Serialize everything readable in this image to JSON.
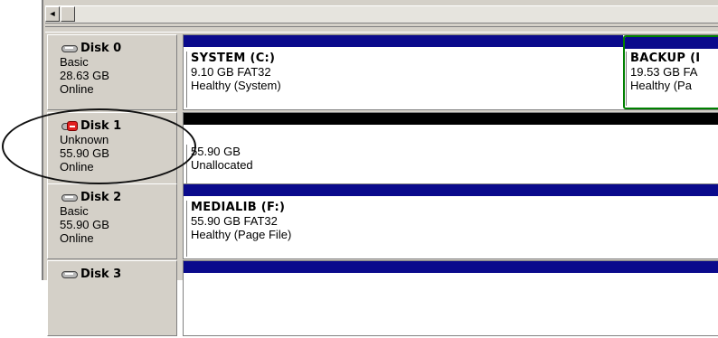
{
  "colors": {
    "primary_partition_bar": "#0a0a8c",
    "unallocated_bar": "#000000",
    "selection_border": "#008000",
    "window_face": "#d4d0c8"
  },
  "scrollbar": {
    "left_arrow_icon": "◄"
  },
  "disks": [
    {
      "name": "Disk 0",
      "icon": "hard-disk-icon",
      "type": "Basic",
      "size": "28.63 GB",
      "status": "Online",
      "partitions": [
        {
          "title": "SYSTEM  (C:)",
          "detail": "9.10 GB FAT32",
          "status": "Healthy (System)"
        },
        {
          "title": "BACKUP  (I",
          "detail": "19.53 GB FA",
          "status": "Healthy (Pa"
        }
      ]
    },
    {
      "name": "Disk 1",
      "icon": "hard-disk-error-icon",
      "type": "Unknown",
      "size": "55.90 GB",
      "status": "Online",
      "partitions": [
        {
          "detail": "55.90 GB",
          "status": "Unallocated"
        }
      ]
    },
    {
      "name": "Disk 2",
      "icon": "hard-disk-icon",
      "type": "Basic",
      "size": "55.90 GB",
      "status": "Online",
      "partitions": [
        {
          "title": "MEDIALIB  (F:)",
          "detail": "55.90 GB FAT32",
          "status": "Healthy (Page File)"
        }
      ]
    },
    {
      "name": "Disk 3",
      "icon": "hard-disk-icon"
    }
  ]
}
